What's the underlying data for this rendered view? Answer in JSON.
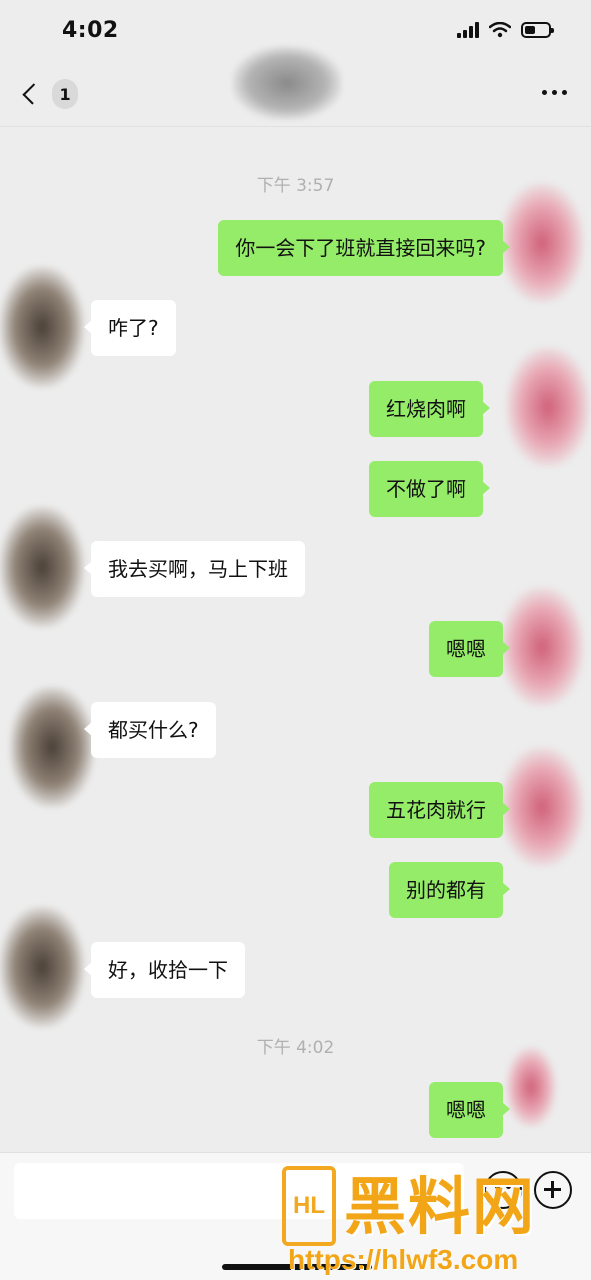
{
  "status_bar": {
    "time": "4:02",
    "battery_level": 0.45
  },
  "nav": {
    "unread_count": "1",
    "more_icon": "ellipsis-icon",
    "back_icon": "chevron-left-icon"
  },
  "colors": {
    "outgoing_bubble": "#95ec69",
    "incoming_bubble": "#ffffff",
    "background": "#ededed",
    "watermark": "#f2a516"
  },
  "chat": {
    "timestamps": [
      "下午 3:57",
      "下午 4:02"
    ],
    "messages": [
      {
        "side": "right",
        "text": "你一会下了班就直接回来吗?"
      },
      {
        "side": "left",
        "text": "咋了?"
      },
      {
        "side": "right",
        "text": "红烧肉啊"
      },
      {
        "side": "right",
        "text": "不做了啊"
      },
      {
        "side": "left",
        "text": "我去买啊，马上下班"
      },
      {
        "side": "right",
        "text": "嗯嗯"
      },
      {
        "side": "left",
        "text": "都买什么?"
      },
      {
        "side": "right",
        "text": "五花肉就行"
      },
      {
        "side": "right",
        "text": "别的都有"
      },
      {
        "side": "left",
        "text": "好，收拾一下"
      },
      {
        "side": "right",
        "text": "嗯嗯"
      }
    ]
  },
  "input_bar": {
    "emoji_icon": "emoji-icon",
    "plus_icon": "plus-icon"
  },
  "watermark": {
    "name": "黑料网",
    "url": "https://hlwf3.com",
    "logo_text": "HL"
  }
}
